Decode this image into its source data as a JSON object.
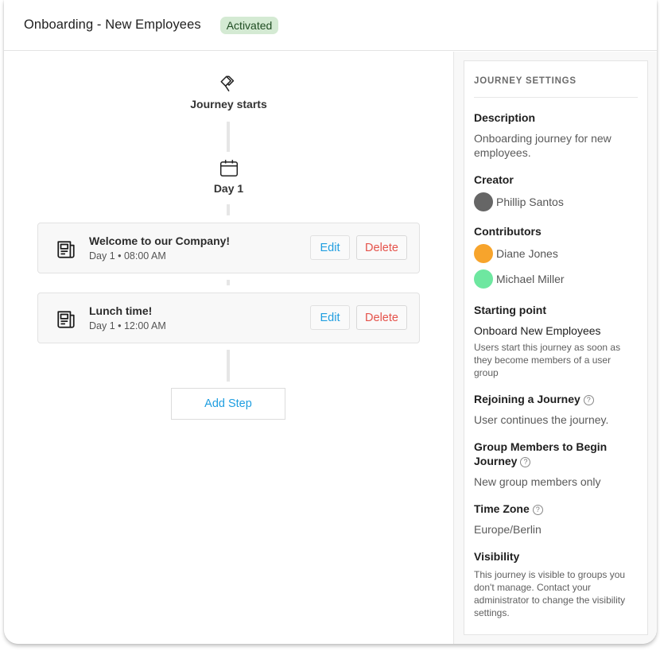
{
  "header": {
    "title": "Onboarding - New Employees",
    "status_badge": "Activated",
    "status_color": "#d4ead3"
  },
  "flow": {
    "start": {
      "icon": "flag-icon",
      "label": "Journey starts"
    },
    "day": {
      "icon": "calendar-icon",
      "label": "Day 1"
    },
    "steps": [
      {
        "icon": "newspaper-icon",
        "title": "Welcome to our Company!",
        "schedule": "Day 1 • 08:00 AM",
        "edit_label": "Edit",
        "delete_label": "Delete"
      },
      {
        "icon": "newspaper-icon",
        "title": "Lunch time!",
        "schedule": "Day 1 • 12:00 AM",
        "edit_label": "Edit",
        "delete_label": "Delete"
      }
    ],
    "add_step_label": "Add Step"
  },
  "settings": {
    "title": "JOURNEY SETTINGS",
    "description": {
      "label": "Description",
      "value": "Onboarding journey for new employees."
    },
    "creator": {
      "label": "Creator",
      "name": "Phillip Santos",
      "avatar_color": "#666666"
    },
    "contributors": {
      "label": "Contributors",
      "people": [
        {
          "name": "Diane Jones",
          "avatar_color": "#f7a42c"
        },
        {
          "name": "Michael Miller",
          "avatar_color": "#6ee7a0"
        }
      ]
    },
    "starting_point": {
      "label": "Starting point",
      "name": "Onboard New Employees",
      "detail": "Users start this journey as soon as they become members of a user group"
    },
    "rejoining": {
      "label": "Rejoining a Journey",
      "value": "User continues the journey."
    },
    "group_members": {
      "label": "Group Members to Begin Journey",
      "value": "New group members only"
    },
    "time_zone": {
      "label": "Time Zone",
      "value": "Europe/Berlin"
    },
    "visibility": {
      "label": "Visibility",
      "value": "This journey is visible to groups you don't manage. Contact your administrator to change the visibility settings."
    },
    "help_glyph": "?"
  }
}
